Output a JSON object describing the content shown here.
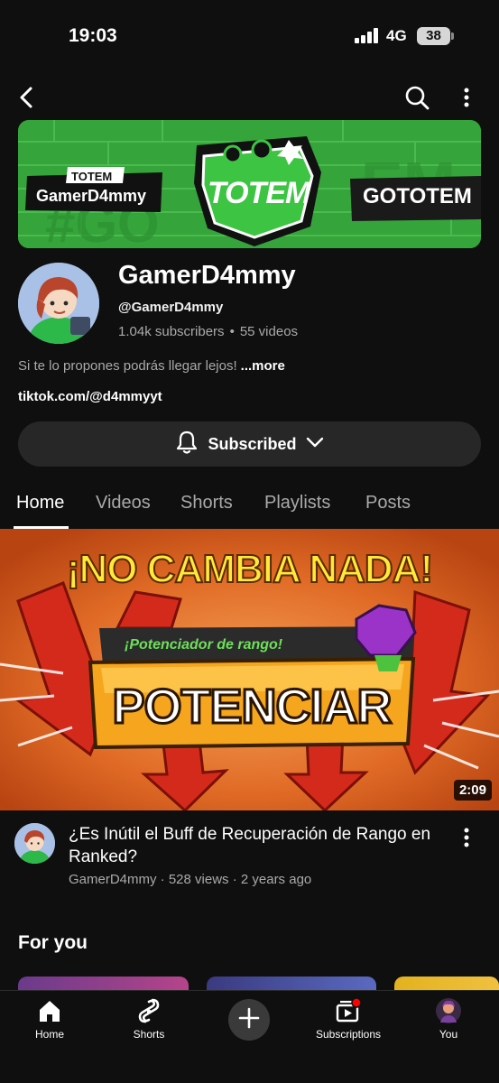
{
  "status_bar": {
    "time": "19:03",
    "network": "4G",
    "battery": "38"
  },
  "banner": {
    "totem_tag": "TOTEM",
    "name_tag": "GamerD4mmy",
    "logo_text": "TOTEM",
    "right_text": "GOTOTEM"
  },
  "channel": {
    "name": "GamerD4mmy",
    "handle": "@GamerD4mmy",
    "subscribers": "1.04k subscribers",
    "videos": "55 videos",
    "description": "Si te lo propones podrás llegar lejos!",
    "more_label": "...more",
    "link": "tiktok.com/@d4mmyyt",
    "subscribe_label": "Subscribed"
  },
  "tabs": [
    {
      "label": "Home"
    },
    {
      "label": "Videos"
    },
    {
      "label": "Shorts"
    },
    {
      "label": "Playlists"
    },
    {
      "label": "Posts"
    }
  ],
  "featured_video": {
    "thumb_headline": "¡NO CAMBIA NADA!",
    "thumb_sublabel": "¡Potenciador de rango!",
    "thumb_button": "POTENCIAR",
    "duration": "2:09",
    "title": "¿Es Inútil el Buff de Recuperación de Rango en Ranked?",
    "meta": "GamerD4mmy · 528 views · 2 years ago"
  },
  "sections": {
    "for_you": "For you"
  },
  "bottom_nav": [
    {
      "label": "Home",
      "icon": "home-icon"
    },
    {
      "label": "Shorts",
      "icon": "shorts-icon"
    },
    {
      "label": "",
      "icon": "plus-icon"
    },
    {
      "label": "Subscriptions",
      "icon": "subscriptions-icon"
    },
    {
      "label": "You",
      "icon": "profile-avatar"
    }
  ],
  "colors": {
    "background": "#0f0f0f",
    "banner_green": "#35a43a",
    "thumb_orange": "#d95f1e",
    "notification_red": "#ff0000"
  }
}
